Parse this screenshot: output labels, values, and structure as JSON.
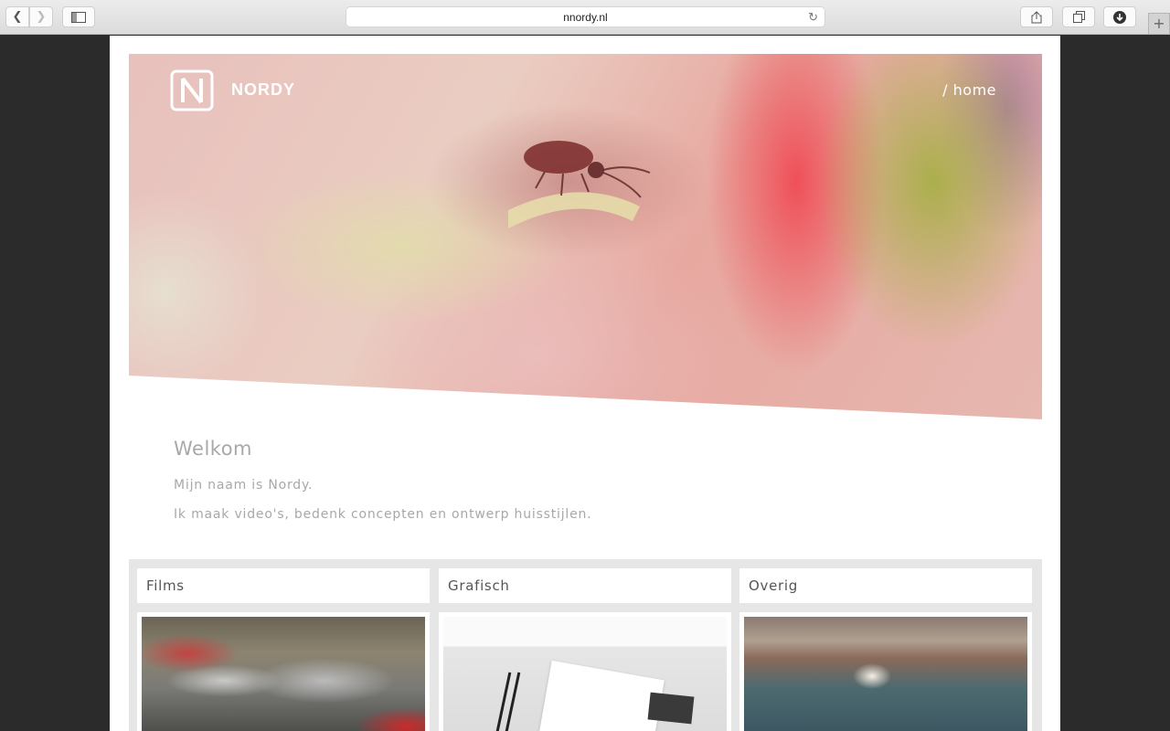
{
  "browser": {
    "url": "nnordy.nl",
    "new_tab_symbol": "+",
    "icons": [
      "chevron-left-icon",
      "chevron-right-icon",
      "sidebar-icon",
      "reload-icon",
      "share-icon",
      "tabs-icon",
      "download-icon"
    ]
  },
  "hero": {
    "brand": "NORDY",
    "nav_link": "/ home"
  },
  "intro": {
    "title": "Welkom",
    "line1": "Mijn naam is Nordy.",
    "line2": "Ik maak video's, bedenk concepten en ontwerp huisstijlen."
  },
  "categories": [
    {
      "label": "Films"
    },
    {
      "label": "Grafisch"
    },
    {
      "label": "Overig"
    }
  ]
}
